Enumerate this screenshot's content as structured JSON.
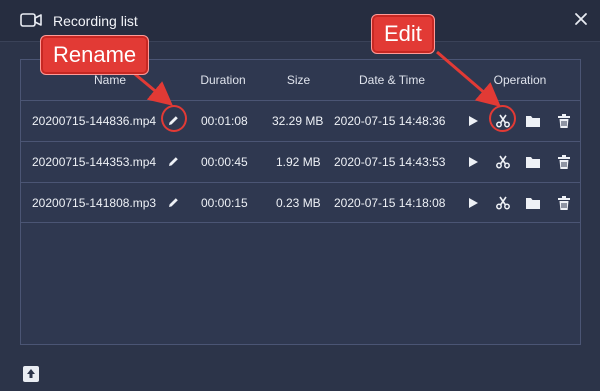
{
  "window": {
    "title": "Recording list",
    "title_icon": "video-camera-icon",
    "close_icon": "close-icon"
  },
  "table": {
    "columns": {
      "name": "Name",
      "duration": "Duration",
      "size": "Size",
      "datetime": "Date & Time",
      "operation": "Operation"
    },
    "rows": [
      {
        "name": "20200715-144836.mp4",
        "duration": "00:01:08",
        "size": "32.29 MB",
        "datetime": "2020-07-15 14:48:36"
      },
      {
        "name": "20200715-144353.mp4",
        "duration": "00:00:45",
        "size": "1.92 MB",
        "datetime": "2020-07-15 14:43:53"
      },
      {
        "name": "20200715-141808.mp3",
        "duration": "00:00:15",
        "size": "0.23 MB",
        "datetime": "2020-07-15 14:18:08"
      }
    ],
    "row_icons": [
      "pencil-icon",
      "play-icon",
      "scissors-icon",
      "folder-icon",
      "trash-icon"
    ]
  },
  "annotations": {
    "rename_label": "Rename",
    "edit_label": "Edit",
    "color": "#e23a35"
  },
  "footer": {
    "upload_icon": "upload-icon"
  },
  "colors": {
    "background": "#2c3449",
    "titlebar": "#262d40",
    "border": "#4b5574"
  }
}
